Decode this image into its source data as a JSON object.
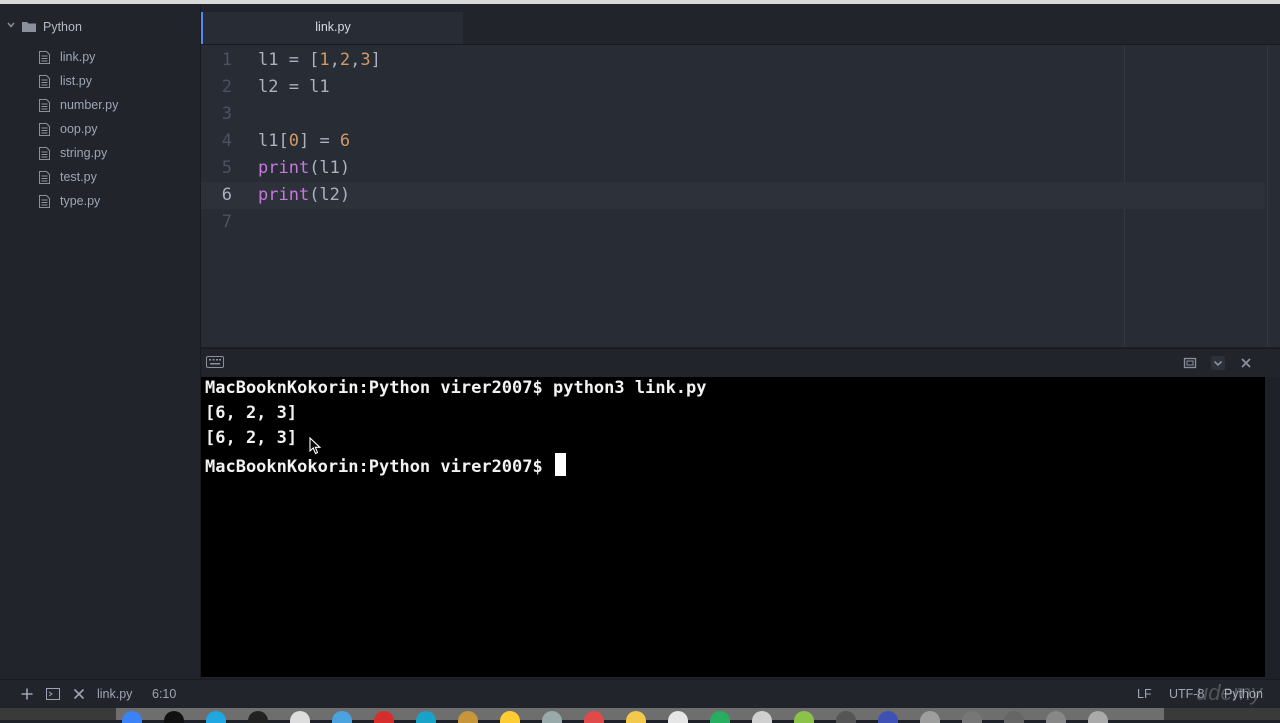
{
  "sidebar": {
    "project": "Python",
    "files": [
      "link.py",
      "list.py",
      "number.py",
      "oop.py",
      "string.py",
      "test.py",
      "type.py"
    ]
  },
  "tabs": [
    {
      "label": "link.py",
      "active": true
    }
  ],
  "editor": {
    "cursor_line": 6,
    "lines": [
      {
        "num": "1",
        "tokens": [
          {
            "t": "l1 = [",
            "c": ""
          },
          {
            "t": "1",
            "c": "num"
          },
          {
            "t": ",",
            "c": ""
          },
          {
            "t": "2",
            "c": "num"
          },
          {
            "t": ",",
            "c": ""
          },
          {
            "t": "3",
            "c": "num"
          },
          {
            "t": "]",
            "c": ""
          }
        ]
      },
      {
        "num": "2",
        "tokens": [
          {
            "t": "l2 = l1",
            "c": ""
          }
        ]
      },
      {
        "num": "3",
        "tokens": []
      },
      {
        "num": "4",
        "tokens": [
          {
            "t": "l1[",
            "c": ""
          },
          {
            "t": "0",
            "c": "num"
          },
          {
            "t": "] = ",
            "c": ""
          },
          {
            "t": "6",
            "c": "num"
          }
        ]
      },
      {
        "num": "5",
        "tokens": [
          {
            "t": "print",
            "c": "kw"
          },
          {
            "t": "(l1)",
            "c": ""
          }
        ]
      },
      {
        "num": "6",
        "tokens": [
          {
            "t": "print",
            "c": "kw"
          },
          {
            "t": "(l2)",
            "c": ""
          }
        ]
      },
      {
        "num": "7",
        "tokens": []
      }
    ]
  },
  "terminal": {
    "lines": [
      "MacBooknKokorin:Python virer2007$ python3 link.py",
      "[6, 2, 3]",
      "[6, 2, 3]"
    ],
    "prompt": "MacBooknKokorin:Python virer2007$ "
  },
  "statusbar": {
    "file": "link.py",
    "position": "6:10",
    "line_ending": "LF",
    "encoding": "UTF-8",
    "grammar": "Python"
  },
  "watermark": "udemy",
  "colors": {
    "accent": "#568af2",
    "keyword": "#c678dd",
    "number": "#d19a66",
    "editor_bg": "#282c34",
    "terminal_bg": "#000000"
  },
  "icons": [
    "chevron-down-icon",
    "folder-icon",
    "file-icon",
    "keyboard-icon",
    "maximize-icon",
    "chevron-down-icon",
    "close-icon",
    "plus-icon",
    "terminal-icon",
    "close-icon",
    "mouse-pointer-icon"
  ]
}
